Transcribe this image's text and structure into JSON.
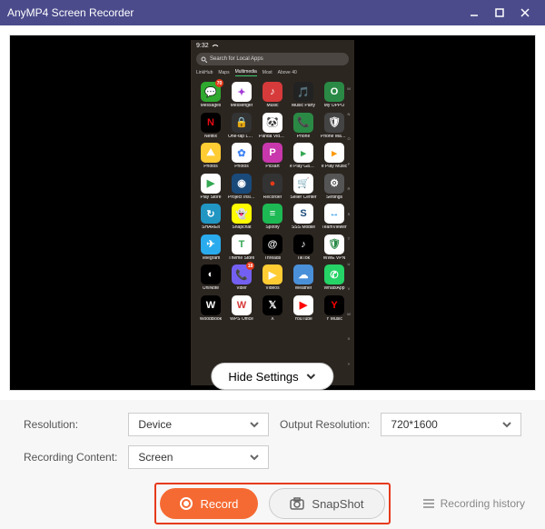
{
  "titlebar": {
    "title": "AnyMP4 Screen Recorder"
  },
  "phone": {
    "time": "9:32",
    "search_placeholder": "Search for Local Apps",
    "tabs": [
      "LinkHub",
      "Maps",
      "Multimedia",
      "Most",
      "Above 40"
    ],
    "active_tab": 2,
    "apps": [
      {
        "label": "Messages",
        "bg": "#2fa82f",
        "glyph": "💬",
        "badge": "70"
      },
      {
        "label": "Messenger",
        "bg": "#fff",
        "glyph": "✦",
        "fg": "#a33bd6"
      },
      {
        "label": "Music",
        "bg": "#d63a3a",
        "glyph": "♪"
      },
      {
        "label": "Music Party",
        "bg": "#222",
        "glyph": "🎵"
      },
      {
        "label": "My OPPO",
        "bg": "#2a8a45",
        "glyph": "O"
      },
      {
        "label": "Netflix",
        "bg": "#000",
        "glyph": "N",
        "fg": "#e50914"
      },
      {
        "label": "One-tap Lock Screen",
        "bg": "#333",
        "glyph": "🔒"
      },
      {
        "label": "Panda Video Compressor",
        "bg": "#fff",
        "glyph": "🐼"
      },
      {
        "label": "Phone",
        "bg": "#2a8a45",
        "glyph": "📞"
      },
      {
        "label": "Phone Manager",
        "bg": "#444",
        "glyph": "🛡"
      },
      {
        "label": "Photos",
        "bg": "#ffcc33",
        "glyph": "⛰"
      },
      {
        "label": "Photos",
        "bg": "#fff",
        "glyph": "✿",
        "fg": "#4285f4"
      },
      {
        "label": "Picsart",
        "bg": "#c837ab",
        "glyph": "P"
      },
      {
        "label": "e Play Games",
        "bg": "#fff",
        "glyph": "▸",
        "fg": "#34a853"
      },
      {
        "label": "e Play Music",
        "bg": "#fff",
        "glyph": "▸",
        "fg": "#ff9800"
      },
      {
        "label": "Play Store",
        "bg": "#fff",
        "glyph": "▶",
        "fg": "#34a853"
      },
      {
        "label": "Project Insight",
        "bg": "#1a4a7a",
        "glyph": "◉"
      },
      {
        "label": "Recorder",
        "bg": "#333",
        "glyph": "●",
        "fg": "#e63a1a"
      },
      {
        "label": "Seller Center",
        "bg": "#fff",
        "glyph": "🛒",
        "fg": "#ee4d2d"
      },
      {
        "label": "Settings",
        "bg": "#555",
        "glyph": "⚙"
      },
      {
        "label": "SHAREit",
        "bg": "#2196c3",
        "glyph": "↻"
      },
      {
        "label": "Snapchat",
        "bg": "#fffc00",
        "glyph": "👻"
      },
      {
        "label": "Spotify",
        "bg": "#1db954",
        "glyph": "≡"
      },
      {
        "label": "SSS Mobile",
        "bg": "#fff",
        "glyph": "S",
        "fg": "#1a4a7a"
      },
      {
        "label": "TeamViewer",
        "bg": "#fff",
        "glyph": "↔",
        "fg": "#0e8ee9"
      },
      {
        "label": "Telegram",
        "bg": "#2aabee",
        "glyph": "✈"
      },
      {
        "label": "Theme Store",
        "bg": "#fff",
        "glyph": "T",
        "fg": "#34a853"
      },
      {
        "label": "Threads",
        "bg": "#000",
        "glyph": "@"
      },
      {
        "label": "TikTok",
        "bg": "#000",
        "glyph": "♪"
      },
      {
        "label": "WWE VPN",
        "bg": "#fff",
        "glyph": "🛡",
        "fg": "#2a8a45"
      },
      {
        "label": "UniNote",
        "bg": "#000",
        "glyph": "◐"
      },
      {
        "label": "Viber",
        "bg": "#7360f2",
        "glyph": "📞",
        "badge": "18"
      },
      {
        "label": "Videos",
        "bg": "#ffcc33",
        "glyph": "▶"
      },
      {
        "label": "Weather",
        "bg": "#4a90d9",
        "glyph": "☁"
      },
      {
        "label": "WhatsApp",
        "bg": "#25d366",
        "glyph": "✆"
      },
      {
        "label": "WoodBook",
        "bg": "#000",
        "glyph": "W"
      },
      {
        "label": "WPS Office",
        "bg": "#fff",
        "glyph": "W",
        "fg": "#d63a3a"
      },
      {
        "label": "X",
        "bg": "#000",
        "glyph": "𝕏"
      },
      {
        "label": "YouTube",
        "bg": "#fff",
        "glyph": "▶",
        "fg": "#ff0000"
      },
      {
        "label": "Y Music",
        "bg": "#000",
        "glyph": "Y",
        "fg": "#ff0000"
      }
    ],
    "az": [
      "M",
      "N",
      "O",
      "P",
      "R",
      "S",
      "T",
      "U",
      "V",
      "W",
      "X",
      "Y"
    ]
  },
  "hide_settings": {
    "label": "Hide Settings"
  },
  "settings": {
    "resolution_label": "Resolution:",
    "resolution_value": "Device",
    "output_label": "Output Resolution:",
    "output_value": "720*1600",
    "content_label": "Recording Content:",
    "content_value": "Screen"
  },
  "actions": {
    "record": "Record",
    "snapshot": "SnapShot",
    "history": "Recording history"
  }
}
